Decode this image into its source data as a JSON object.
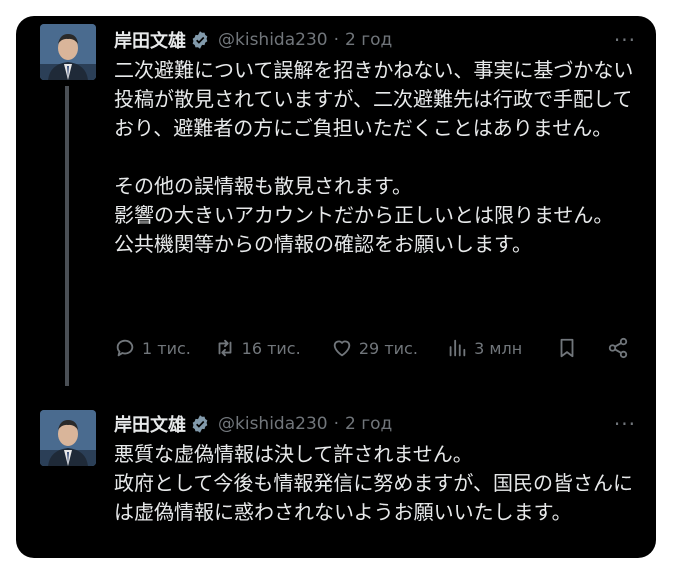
{
  "tweets": [
    {
      "author": {
        "name": "岸田文雄",
        "handle": "@kishida230",
        "verified_color": "#829aab"
      },
      "time": "2 год",
      "more": "···",
      "text": "二次避難について誤解を招きかねない、事実に基づかない投稿が散見されていますが、二次避難先は行政で手配しており、避難者の方にご負担いただくことはありません。\n\nその他の誤情報も散見されます。\n影響の大きいアカウントだから正しいとは限りません。\n公共機関等からの情報の確認をお願いします。",
      "stats": {
        "replies": "1 тис.",
        "retweets": "16 тис.",
        "likes": "29 тис.",
        "views": "3 млн"
      }
    },
    {
      "author": {
        "name": "岸田文雄",
        "handle": "@kishida230",
        "verified_color": "#829aab"
      },
      "time": "2 год",
      "more": "···",
      "text": "悪質な虚偽情報は決して許されません。\n政府として今後も情報発信に努めますが、国民の皆さんには虚偽情報に惑わされないようお願いいたします。"
    }
  ],
  "icons": [
    "reply-icon",
    "retweet-icon",
    "like-icon",
    "views-icon",
    "bookmark-icon",
    "share-icon",
    "verified-badge-icon"
  ],
  "colors": {
    "background": "#000000",
    "text": "#e7e9ea",
    "muted": "#71767b",
    "page": "#ffffff"
  }
}
